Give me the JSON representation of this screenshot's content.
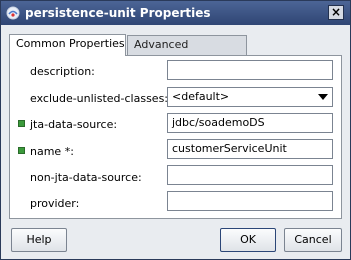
{
  "window": {
    "title": "persistence-unit Properties",
    "close_glyph": "×"
  },
  "tabs": [
    {
      "label": "Common Properties",
      "active": true
    },
    {
      "label": "Advanced Properties",
      "active": false
    }
  ],
  "fields": {
    "description": {
      "label": "description:",
      "value": ""
    },
    "exclude_unlisted_classes": {
      "label": "exclude-unlisted-classes:",
      "value": "<default>"
    },
    "jta_data_source": {
      "label": "jta-data-source:",
      "value": "jdbc/soademoDS"
    },
    "name": {
      "label": "name *:",
      "value": "customerServiceUnit"
    },
    "non_jta_data_source": {
      "label": "non-jta-data-source:",
      "value": ""
    },
    "provider": {
      "label": "provider:",
      "value": ""
    }
  },
  "buttons": {
    "help": "Help",
    "ok": "OK",
    "cancel": "Cancel"
  },
  "colors": {
    "title_bar": "#3a5486",
    "set_marker": "#3b9a3b"
  }
}
